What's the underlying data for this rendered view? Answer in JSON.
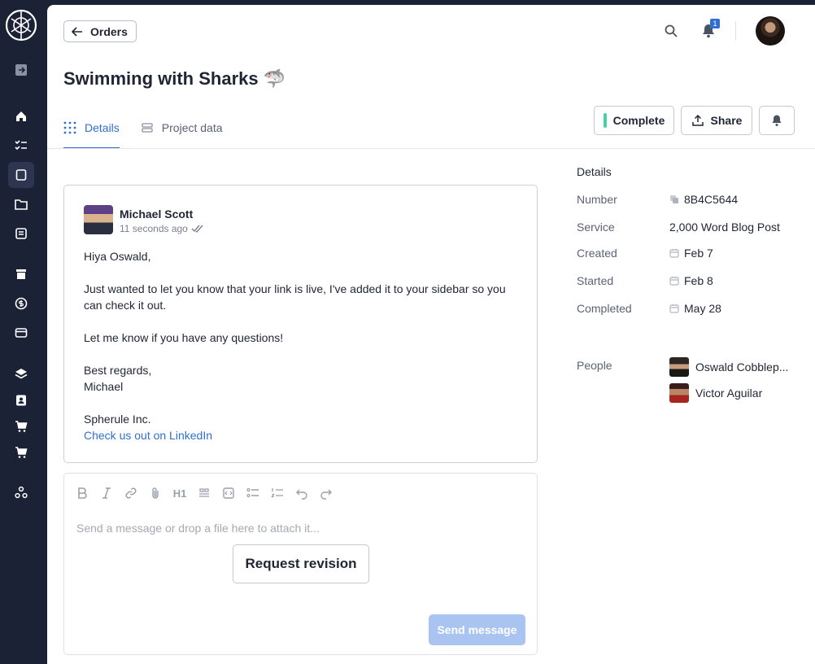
{
  "header": {
    "back_label": "Orders",
    "notification_count": "1"
  },
  "page": {
    "title": "Swimming with Sharks",
    "title_emoji": "🦈"
  },
  "tabs": [
    {
      "label": "Details",
      "active": true
    },
    {
      "label": "Project data",
      "active": false
    }
  ],
  "actions": {
    "complete_label": "Complete",
    "share_label": "Share"
  },
  "message": {
    "author": "Michael Scott",
    "time": "11 seconds ago",
    "greeting": "Hiya Oswald,",
    "body": "Just wanted to let you know that your link is live, I've added it to your sidebar so you can check it out.",
    "questions": "Let me know if you have any questions!",
    "signoff": "Best regards,",
    "signer": "Michael",
    "company": "Spherule Inc.",
    "link_text": "Check us out on LinkedIn"
  },
  "composer": {
    "placeholder": "Send a message or drop a file here to attach it...",
    "request_revision_label": "Request revision",
    "send_label": "Send message",
    "toolbar": [
      "bold-icon",
      "italic-icon",
      "link-icon",
      "attach-icon",
      "heading-icon",
      "quote-icon",
      "code-icon",
      "bullet-list-icon",
      "numbered-list-icon",
      "undo-icon",
      "redo-icon"
    ],
    "heading_glyph": "H1"
  },
  "details": {
    "title": "Details",
    "rows": [
      {
        "label": "Number",
        "value": "8B4C5644"
      },
      {
        "label": "Service",
        "value": "2,000 Word Blog Post"
      },
      {
        "label": "Created",
        "value": "Feb 7"
      },
      {
        "label": "Started",
        "value": "Feb 8"
      },
      {
        "label": "Completed",
        "value": "May 28"
      }
    ],
    "people_label": "People",
    "people": [
      {
        "name": "Oswald Cobblep..."
      },
      {
        "name": "Victor Aguilar"
      }
    ]
  },
  "colors": {
    "sidebar_bg": "#1c2236",
    "accent": "#2f6fd1",
    "complete_bar": "#4ad0a1",
    "send_disabled": "#a9c4f1"
  }
}
